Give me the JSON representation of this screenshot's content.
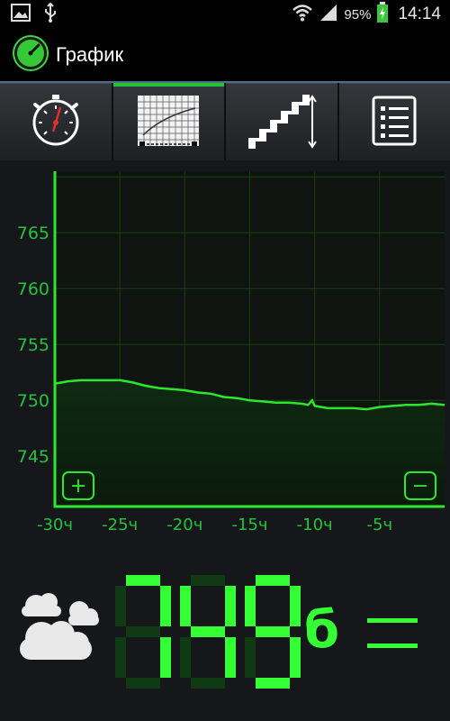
{
  "status_bar": {
    "battery_text": "95%",
    "time": "14:14"
  },
  "action_bar": {
    "title": "График",
    "icon": "gauge-icon"
  },
  "tabs": [
    {
      "name": "barometer-tab",
      "icon": "gauge-icon",
      "active": false
    },
    {
      "name": "graph-tab",
      "icon": "graph-icon",
      "active": true
    },
    {
      "name": "altimeter-tab",
      "icon": "stairs-arrow-icon",
      "active": false
    },
    {
      "name": "log-tab",
      "icon": "list-icon",
      "active": false
    }
  ],
  "chart_data": {
    "type": "line",
    "x": [
      -30,
      -29,
      -28,
      -27,
      -26,
      -25,
      -24,
      -23,
      -22,
      -21,
      -20,
      -19,
      -18,
      -17,
      -16,
      -15,
      -14,
      -13,
      -12,
      -11,
      -10.5,
      -10.2,
      -10,
      -9.5,
      -9,
      -8,
      -7,
      -6,
      -5,
      -4,
      -3,
      -2,
      -1,
      0
    ],
    "y": [
      751.5,
      751.7,
      751.8,
      751.8,
      751.8,
      751.8,
      751.6,
      751.3,
      751.1,
      751.0,
      750.9,
      750.7,
      750.6,
      750.3,
      750.2,
      750.0,
      749.9,
      749.8,
      749.8,
      749.7,
      749.6,
      750.0,
      749.5,
      749.4,
      749.3,
      749.3,
      749.3,
      749.2,
      749.4,
      749.5,
      749.6,
      749.6,
      749.7,
      749.6
    ],
    "xlim": [
      -30,
      0
    ],
    "ylim": [
      740.5,
      770.5
    ],
    "x_ticks": [
      -30,
      -25,
      -20,
      -15,
      -10,
      -5
    ],
    "x_tick_labels": [
      "-30ч",
      "-25ч",
      "-20ч",
      "-15ч",
      "-10ч",
      "-5ч"
    ],
    "y_ticks": [
      745,
      750,
      755,
      760,
      765
    ],
    "y_tick_labels": [
      "745",
      "750",
      "755",
      "760",
      "765"
    ],
    "grid": true,
    "zoom_in_label": "+",
    "zoom_out_label": "−"
  },
  "readout": {
    "value": "749",
    "unit": "б",
    "weather_icon": "cloudy-icon",
    "trend_icon": "steady-trend-icon"
  },
  "colors": {
    "accent": "#25c33c",
    "digit": "#35ff35",
    "digit_dim": "#0f3a14",
    "line": "#2ee62e",
    "grid": "#144214"
  }
}
